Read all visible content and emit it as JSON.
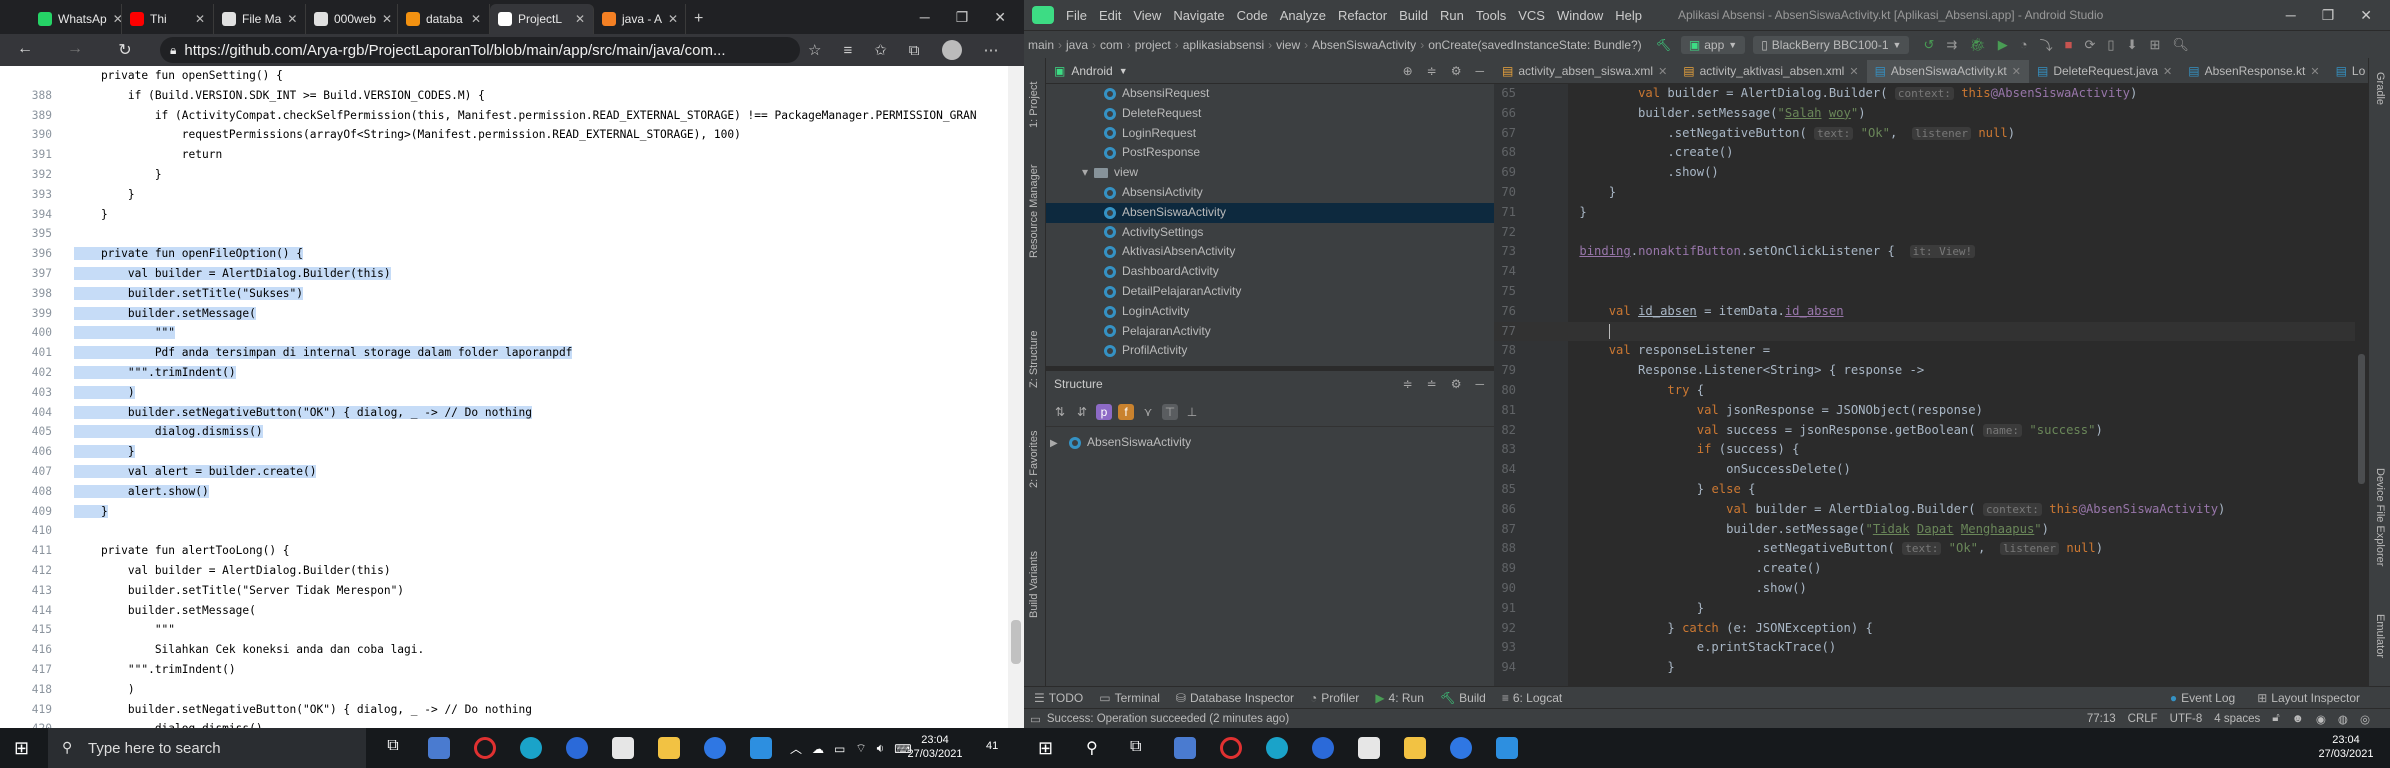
{
  "browser": {
    "tabs": [
      {
        "label": "WhatsAp",
        "color": "#25d366"
      },
      {
        "label": "Thi",
        "color": "#ff0000"
      },
      {
        "label": "File Ma",
        "color": "#e0e0e0"
      },
      {
        "label": "000web",
        "color": "#e0e0e0"
      },
      {
        "label": "databa",
        "color": "#f29111"
      },
      {
        "label": "ProjectL",
        "color": "#ffffff"
      },
      {
        "label": "java - A",
        "color": "#f48024"
      }
    ],
    "url": "https://github.com/Arya-rgb/ProjectLaporanTol/blob/main/app/src/main/java/com...",
    "code": [
      {
        "n": "",
        "t": "    private fun openSetting() {",
        "sel": false
      },
      {
        "n": "388",
        "t": "        if (Build.VERSION.SDK_INT >= Build.VERSION_CODES.M) {",
        "sel": false
      },
      {
        "n": "389",
        "t": "            if (ActivityCompat.checkSelfPermission(this, Manifest.permission.READ_EXTERNAL_STORAGE) !== PackageManager.PERMISSION_GRAN",
        "sel": false
      },
      {
        "n": "390",
        "t": "                requestPermissions(arrayOf<String>(Manifest.permission.READ_EXTERNAL_STORAGE), 100)",
        "sel": false
      },
      {
        "n": "391",
        "t": "                return",
        "sel": false
      },
      {
        "n": "392",
        "t": "            }",
        "sel": false
      },
      {
        "n": "393",
        "t": "        }",
        "sel": false
      },
      {
        "n": "394",
        "t": "    }",
        "sel": false
      },
      {
        "n": "395",
        "t": "",
        "sel": false
      },
      {
        "n": "396",
        "t": "    private fun openFileOption() {",
        "sel": true
      },
      {
        "n": "397",
        "t": "        val builder = AlertDialog.Builder(this)",
        "sel": true
      },
      {
        "n": "398",
        "t": "        builder.setTitle(\"Sukses\")",
        "sel": true
      },
      {
        "n": "399",
        "t": "        builder.setMessage(",
        "sel": true
      },
      {
        "n": "400",
        "t": "            \"\"\"",
        "sel": true
      },
      {
        "n": "401",
        "t": "            Pdf anda tersimpan di internal storage dalam folder laporanpdf",
        "sel": true
      },
      {
        "n": "402",
        "t": "        \"\"\".trimIndent()",
        "sel": true
      },
      {
        "n": "403",
        "t": "        )",
        "sel": true
      },
      {
        "n": "404",
        "t": "        builder.setNegativeButton(\"OK\") { dialog, _ -> // Do nothing",
        "sel": true
      },
      {
        "n": "405",
        "t": "            dialog.dismiss()",
        "sel": true
      },
      {
        "n": "406",
        "t": "        }",
        "sel": true
      },
      {
        "n": "407",
        "t": "        val alert = builder.create()",
        "sel": true
      },
      {
        "n": "408",
        "t": "        alert.show()",
        "sel": true
      },
      {
        "n": "409",
        "t": "    }",
        "sel": true
      },
      {
        "n": "410",
        "t": "",
        "sel": false
      },
      {
        "n": "411",
        "t": "    private fun alertTooLong() {",
        "sel": false
      },
      {
        "n": "412",
        "t": "        val builder = AlertDialog.Builder(this)",
        "sel": false
      },
      {
        "n": "413",
        "t": "        builder.setTitle(\"Server Tidak Merespon\")",
        "sel": false
      },
      {
        "n": "414",
        "t": "        builder.setMessage(",
        "sel": false
      },
      {
        "n": "415",
        "t": "            \"\"\"",
        "sel": false
      },
      {
        "n": "416",
        "t": "            Silahkan Cek koneksi anda dan coba lagi.",
        "sel": false
      },
      {
        "n": "417",
        "t": "        \"\"\".trimIndent()",
        "sel": false
      },
      {
        "n": "418",
        "t": "        )",
        "sel": false
      },
      {
        "n": "419",
        "t": "        builder.setNegativeButton(\"OK\") { dialog, _ -> // Do nothing",
        "sel": false
      },
      {
        "n": "420",
        "t": "            dialog.dismiss()",
        "sel": false
      }
    ]
  },
  "studio": {
    "menu": [
      "File",
      "Edit",
      "View",
      "Navigate",
      "Code",
      "Analyze",
      "Refactor",
      "Build",
      "Run",
      "Tools",
      "VCS",
      "Window",
      "Help"
    ],
    "window_title": "Aplikasi Absensi - AbsenSiswaActivity.kt [Aplikasi_Absensi.app] - Android Studio",
    "breadcrumbs": [
      "main",
      "java",
      "com",
      "project",
      "aplikasiabsensi",
      "view",
      "AbsenSiswaActivity",
      "onCreate(savedInstanceState: Bundle?)"
    ],
    "run_config": "app",
    "device": "BlackBerry BBC100-1",
    "project_view": "Android",
    "tree": [
      {
        "label": "AbsensiRequest",
        "type": "class",
        "indent": 2,
        "sel": false
      },
      {
        "label": "DeleteRequest",
        "type": "class",
        "indent": 2,
        "sel": false
      },
      {
        "label": "LoginRequest",
        "type": "class",
        "indent": 2,
        "sel": false
      },
      {
        "label": "PostResponse",
        "type": "class",
        "indent": 2,
        "sel": false
      },
      {
        "label": "view",
        "type": "folder",
        "indent": 1,
        "sel": false
      },
      {
        "label": "AbsensiActivity",
        "type": "class",
        "indent": 2,
        "sel": false
      },
      {
        "label": "AbsenSiswaActivity",
        "type": "class",
        "indent": 2,
        "sel": true
      },
      {
        "label": "ActivitySettings",
        "type": "class",
        "indent": 2,
        "sel": false
      },
      {
        "label": "AktivasiAbsenActivity",
        "type": "class",
        "indent": 2,
        "sel": false
      },
      {
        "label": "DashboardActivity",
        "type": "class",
        "indent": 2,
        "sel": false
      },
      {
        "label": "DetailPelajaranActivity",
        "type": "class",
        "indent": 2,
        "sel": false
      },
      {
        "label": "LoginActivity",
        "type": "class",
        "indent": 2,
        "sel": false
      },
      {
        "label": "PelajaranActivity",
        "type": "class",
        "indent": 2,
        "sel": false
      },
      {
        "label": "ProfilActivity",
        "type": "class",
        "indent": 2,
        "sel": false
      }
    ],
    "structure_title": "Structure",
    "structure_item": "AbsenSiswaActivity",
    "left_strip": [
      "1: Project",
      "Resource Manager",
      "Z: Structure",
      "2: Favorites",
      "Build Variants"
    ],
    "right_strip": [
      "Gradle",
      "Device File Explorer",
      "Emulator"
    ],
    "editor_tabs": [
      {
        "label": "activity_absen_siswa.xml",
        "active": false
      },
      {
        "label": "activity_aktivasi_absen.xml",
        "active": false
      },
      {
        "label": "AbsenSiswaActivity.kt",
        "active": true
      },
      {
        "label": "DeleteRequest.java",
        "active": false
      },
      {
        "label": "AbsenResponse.kt",
        "active": false
      },
      {
        "label": "Lo",
        "active": false
      }
    ],
    "bottom_tools": [
      "TODO",
      "Terminal",
      "Database Inspector",
      "Profiler",
      "4: Run",
      "Build",
      "6: Logcat",
      "Event Log",
      "Layout Inspector"
    ],
    "status_message": "Success: Operation succeeded (2 minutes ago)",
    "status_right": [
      "77:13",
      "CRLF",
      "UTF-8",
      "4 spaces"
    ]
  },
  "taskbar_left": {
    "search_placeholder": "Type here to search",
    "time": "23:04",
    "date": "27/03/2021",
    "badge": "41"
  },
  "taskbar_right": {
    "time": "23:04",
    "date": "27/03/2021"
  }
}
